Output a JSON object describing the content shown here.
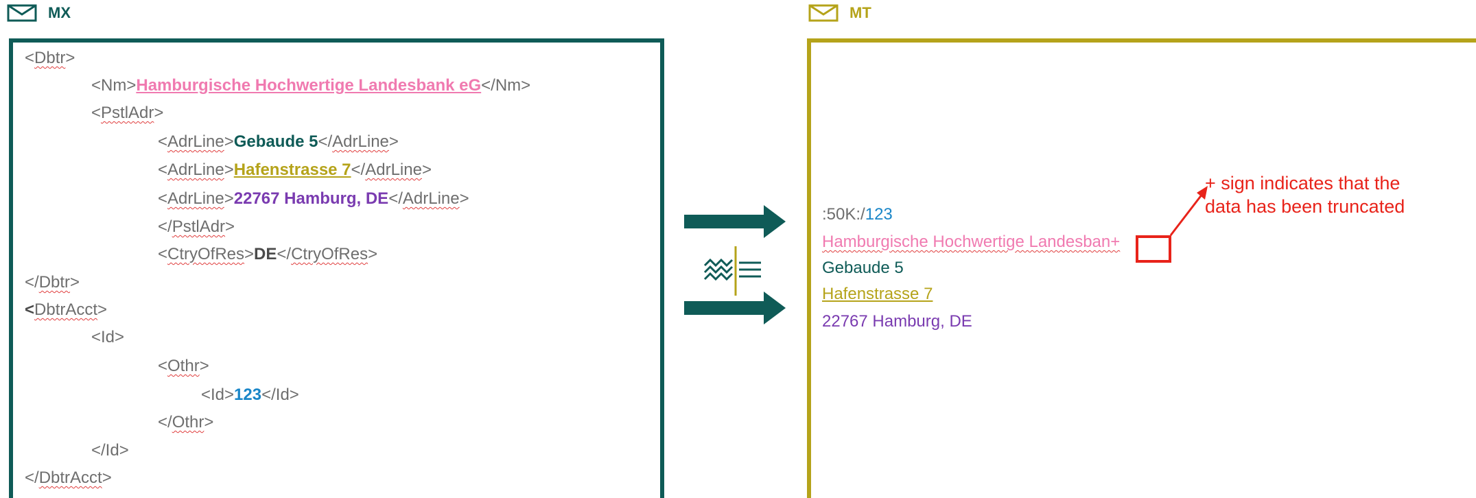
{
  "mx_panel": {
    "label": "MX",
    "lines": [
      {
        "open": "<",
        "tag": "Dbtr",
        "close": ">"
      },
      {
        "pre": "<Nm>",
        "value": "Hamburgische Hochwertige Landesbank eG",
        "post": "</Nm>"
      },
      {
        "open": "<",
        "tag": "PstlAdr",
        "close": ">"
      },
      {
        "pre_open": "<",
        "pre_tag": "AdrLine",
        "pre_close": ">",
        "value": "Gebaude 5",
        "post_open": "</",
        "post_tag": "AdrLine",
        "post_close": ">"
      },
      {
        "pre_open": "<",
        "pre_tag": "AdrLine",
        "pre_close": ">",
        "value": "Hafenstrasse 7",
        "post_open": "</",
        "post_tag": "AdrLine",
        "post_close": ">"
      },
      {
        "pre_open": "<",
        "pre_tag": "AdrLine",
        "pre_close": ">",
        "value": "22767 Hamburg, DE",
        "post_open": "</",
        "post_tag": "AdrLine",
        "post_close": ">"
      },
      {
        "open": "</",
        "tag": "PstlAdr",
        "close": ">"
      },
      {
        "pre_open": "<",
        "pre_tag": "CtryOfRes",
        "pre_close": ">",
        "value": "DE",
        "post_open": "</",
        "post_tag": "CtryOfRes",
        "post_close": ">"
      },
      {
        "open": "</",
        "tag": "Dbtr",
        "close": ">"
      },
      {
        "open": "<",
        "tag": "DbtrAcct",
        "close": ">"
      },
      {
        "text": "<Id>"
      },
      {
        "open": "<",
        "tag": "Othr",
        "close": ">"
      },
      {
        "pre": "<Id>",
        "value": "123",
        "post": "</Id>"
      },
      {
        "open": "</",
        "tag": "Othr",
        "close": ">"
      },
      {
        "text": "</Id>"
      },
      {
        "open": "</",
        "tag": "DbtrAcct",
        "close": ">"
      }
    ]
  },
  "mt_panel": {
    "label": "MT",
    "field_tag": ":50K:/",
    "account": "123",
    "name_line": "Hamburgische Hochwertige Landesban+",
    "line2": "Gebaude 5",
    "line3": "Hafenstrasse 7",
    "line4": "22767 Hamburg, DE"
  },
  "annotation": {
    "line1": "+ sign indicates that the",
    "line2": "data has been truncated"
  },
  "colors": {
    "mx": "#0f5b57",
    "mt": "#b5a31a",
    "annotation": "#e8231a"
  },
  "icons": [
    "envelope-icon",
    "translation-icon",
    "arrow-right-icon"
  ]
}
